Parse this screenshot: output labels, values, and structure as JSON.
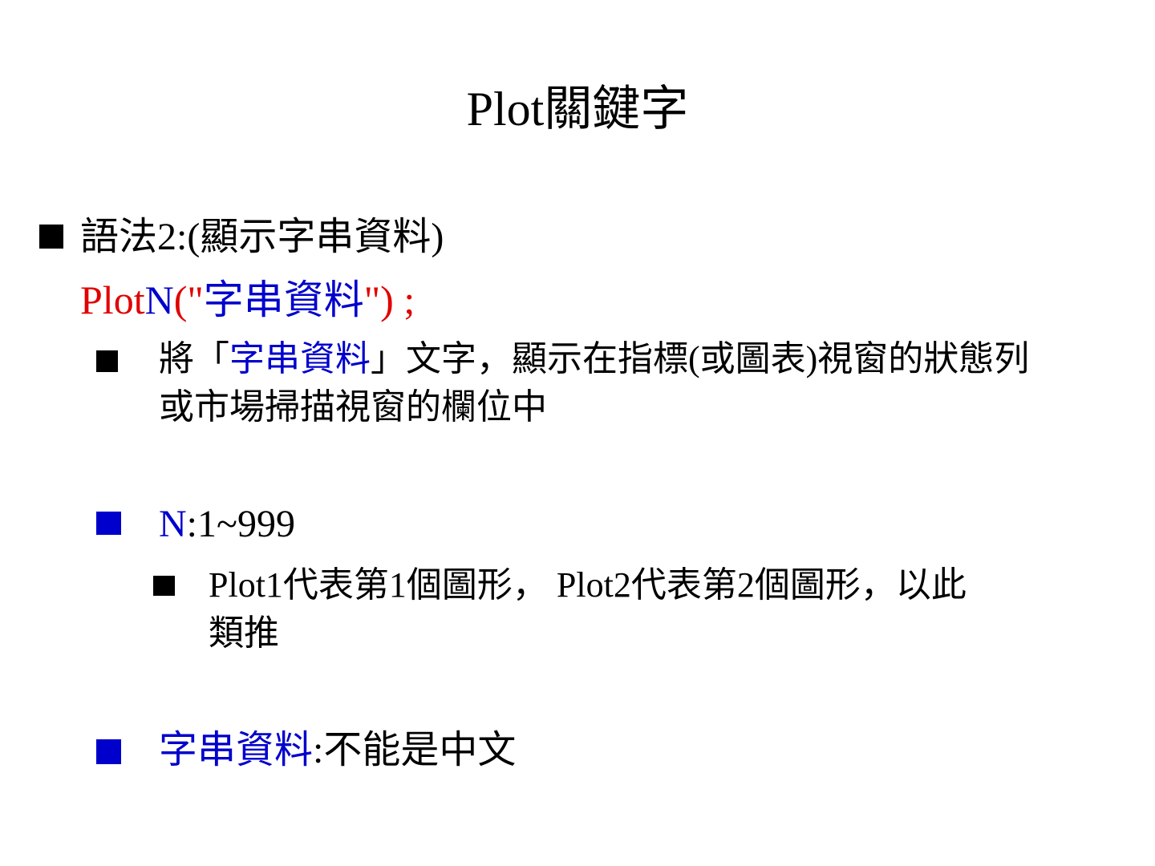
{
  "title": "Plot關鍵字",
  "syntax": {
    "label": "語法2:(顯示字串資料)",
    "code_plot": "Plot",
    "code_n": "N",
    "code_open": "(\"",
    "code_string": "字串資料",
    "code_close": "\") ;"
  },
  "desc": {
    "prefix": "將「",
    "highlight": "字串資料",
    "suffix": "」文字，顯示在指標(或圖表)視窗的狀態列",
    "line2": "或市場掃描視窗的欄位中"
  },
  "n_item": {
    "n": "N",
    "range": ":1~999"
  },
  "n_sub": {
    "line1": "Plot1代表第1個圖形，  Plot2代表第2個圖形，以此",
    "line2": "類推"
  },
  "string_item": {
    "label": "字串資料",
    "rest": ":不能是中文"
  },
  "colors": {
    "red": "#e00000",
    "blue": "#0000cc",
    "black": "#000000"
  }
}
